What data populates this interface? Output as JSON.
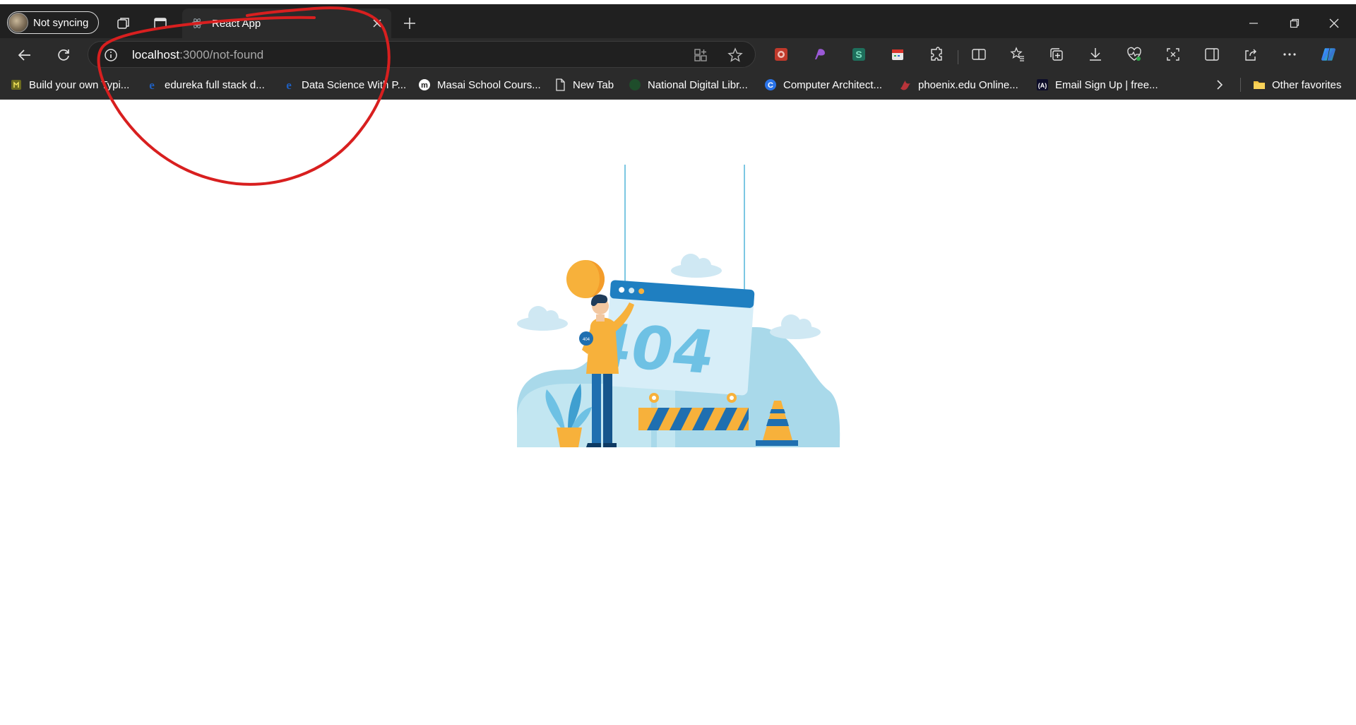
{
  "profile": {
    "label": "Not syncing"
  },
  "tab": {
    "title": "React App"
  },
  "address": {
    "host": "localhost",
    "path": ":3000/not-found"
  },
  "bookmarks": [
    {
      "label": "Build your own Typi..."
    },
    {
      "label": "edureka full stack d..."
    },
    {
      "label": "Data Science With P..."
    },
    {
      "label": "Masai School Cours..."
    },
    {
      "label": "New Tab"
    },
    {
      "label": "National Digital Libr..."
    },
    {
      "label": "Computer Architect..."
    },
    {
      "label": "phoenix.edu Online..."
    },
    {
      "label": "Email Sign Up | free..."
    }
  ],
  "other_favorites": {
    "label": "Other favorites"
  },
  "page": {
    "illustration_text": "404"
  },
  "colors": {
    "annotation_red": "#d81f1f",
    "brand_blue": "#1f7fc1",
    "light_blue": "#a9d9ea",
    "accent_yellow": "#f6b23a"
  }
}
